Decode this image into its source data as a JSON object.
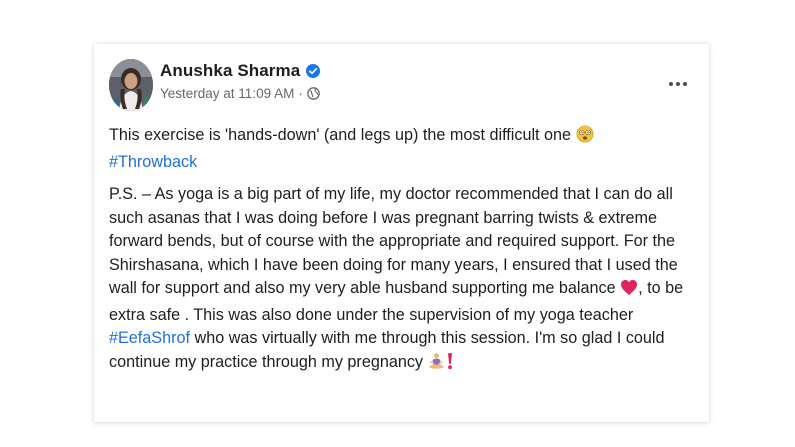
{
  "post": {
    "author": {
      "name": "Anushka Sharma",
      "verified": true,
      "verified_icon": "verified-badge-icon",
      "avatar_icon": "profile-avatar"
    },
    "timestamp": "Yesterday at 11:09 AM",
    "separator": "·",
    "audience_icon": "globe-icon",
    "more_icon": "more-options-icon",
    "paragraph_1": {
      "text_a": "This exercise is 'hands-down' (and legs up) the most difficult one ",
      "emoji_a": "dizzy-face-emoji",
      "hashtag": "#Throwback"
    },
    "paragraph_2": {
      "text_a": "P.S. – As yoga is a big part of my life, my doctor recommended that I can do all such asanas that I was doing before I was pregnant barring twists & extreme forward bends, but of course with the appropriate and required support. For the Shirshasana, which I have been doing for many years, I ensured that I used the wall for support and also my very able husband supporting me balance ",
      "emoji_heart": "red-heart-emoji",
      "text_b": ", to be extra safe . This was also done under the supervision of my yoga teacher ",
      "hashtag": "#EefaShrof",
      "text_c": " who was virtually with me through this session. I'm so glad I could continue my practice through my pregnancy ",
      "emoji_yoga": "person-in-lotus-position-emoji",
      "emoji_exclaim": "red-exclamation-emoji"
    },
    "colors": {
      "hashtag": "#216fdb",
      "verified": "#1877f2",
      "meta_text": "#65676b",
      "heart": "#e0245e"
    }
  }
}
